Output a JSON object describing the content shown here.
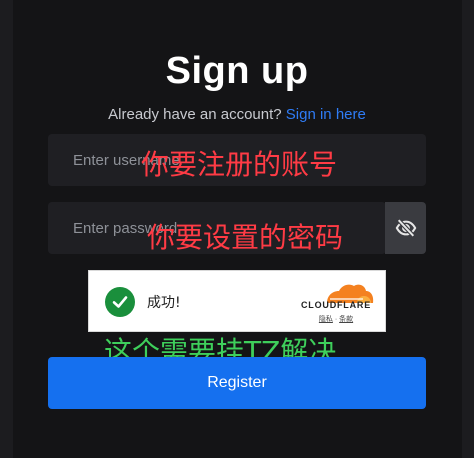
{
  "page": {
    "title": "Sign up"
  },
  "signin": {
    "prompt": "Already have an account? ",
    "link": "Sign in here"
  },
  "form": {
    "username_placeholder": "Enter username",
    "password_placeholder": "Enter password",
    "register_label": "Register"
  },
  "captcha": {
    "status": "成功!",
    "brand": "CLOUDFLARE",
    "privacy": "隐私",
    "separator": " · ",
    "terms": "条款"
  },
  "annotations": {
    "username_note": "你要注册的账号",
    "password_note": "你要设置的密码",
    "captcha_note": "这个需要挂TZ解决"
  },
  "colors": {
    "background": "#141416",
    "accent": "#1570ef",
    "link": "#2f7cf6",
    "annotation_red": "#ff3b45",
    "annotation_green": "#3ecf5b",
    "success": "#1a8f3c"
  },
  "icons": {
    "password_toggle": "eye-slash-icon",
    "success": "checkmark-icon",
    "brand": "cloudflare-logo-icon"
  }
}
